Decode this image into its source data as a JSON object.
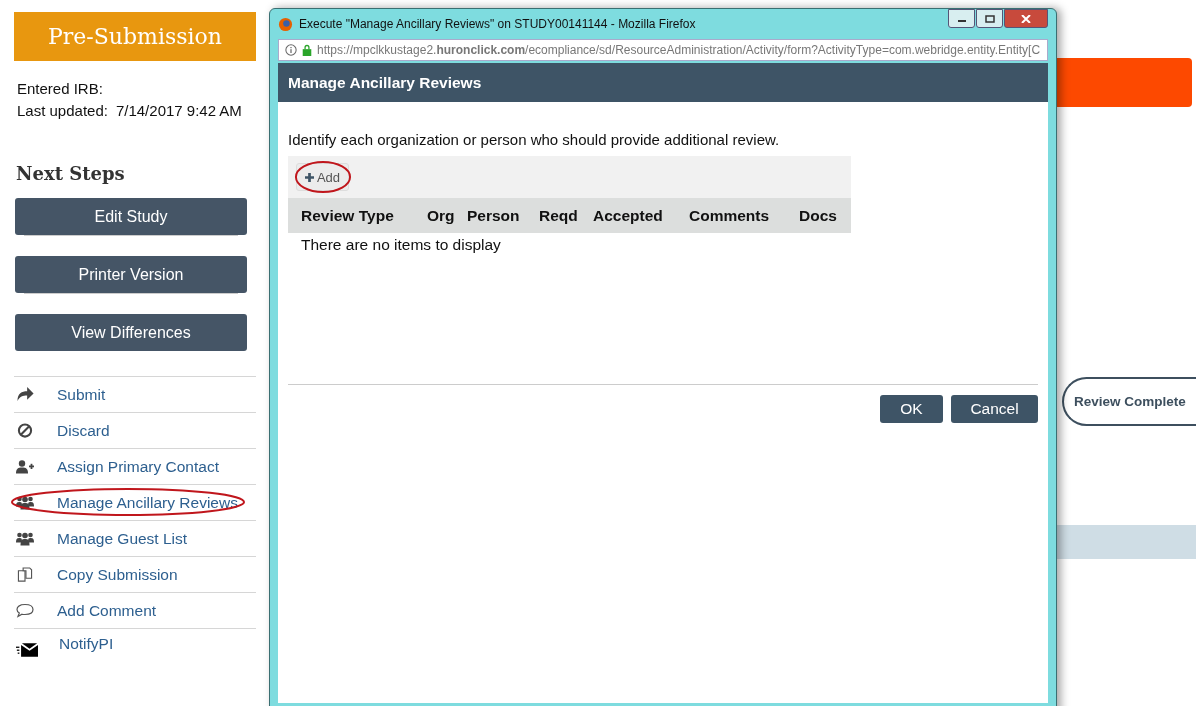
{
  "status_banner": "Pre-Submission",
  "entered_irb": {
    "label": "Entered IRB:"
  },
  "last_updated": {
    "label": "Last updated:",
    "value": "7/14/2017 9:42 AM"
  },
  "next_steps": {
    "title": "Next Steps",
    "buttons": [
      "Edit Study",
      "Printer Version",
      "View Differences"
    ],
    "actions": [
      {
        "label": "Submit",
        "kind": "submit",
        "circled": false
      },
      {
        "label": "Discard",
        "kind": "discard",
        "circled": false
      },
      {
        "label": "Assign Primary Contact",
        "kind": "add-person",
        "circled": false
      },
      {
        "label": "Manage Ancillary Reviews",
        "kind": "group",
        "circled": true
      },
      {
        "label": "Manage Guest List",
        "kind": "group",
        "circled": false
      },
      {
        "label": "Copy Submission",
        "kind": "copy",
        "circled": false
      },
      {
        "label": "Add Comment",
        "kind": "comment",
        "circled": false
      },
      {
        "label": "NotifyPI",
        "kind": "mail",
        "circled": false
      }
    ]
  },
  "workflow": {
    "node": "Review Complete"
  },
  "browser_window": {
    "title": "Execute \"Manage Ancillary Reviews\" on STUDY00141144 - Mozilla Firefox",
    "url": "https://mpclkkustage2.**huronclick.com**/ecompliance/sd/ResourceAdministration/Activity/form?ActivityType=com.webridge.entity.Entity[C",
    "dialog": {
      "title": "Manage Ancillary Reviews",
      "instruction": "Identify each organization or person who should provide additional review.",
      "add_button": {
        "label": "Add",
        "circled": true
      },
      "table": {
        "columns": [
          "Review Type",
          "Org",
          "Person",
          "Reqd",
          "Accepted",
          "Comments",
          "Docs"
        ],
        "empty_message": "There are no items to display"
      },
      "buttons": [
        "OK",
        "Cancel"
      ]
    }
  }
}
